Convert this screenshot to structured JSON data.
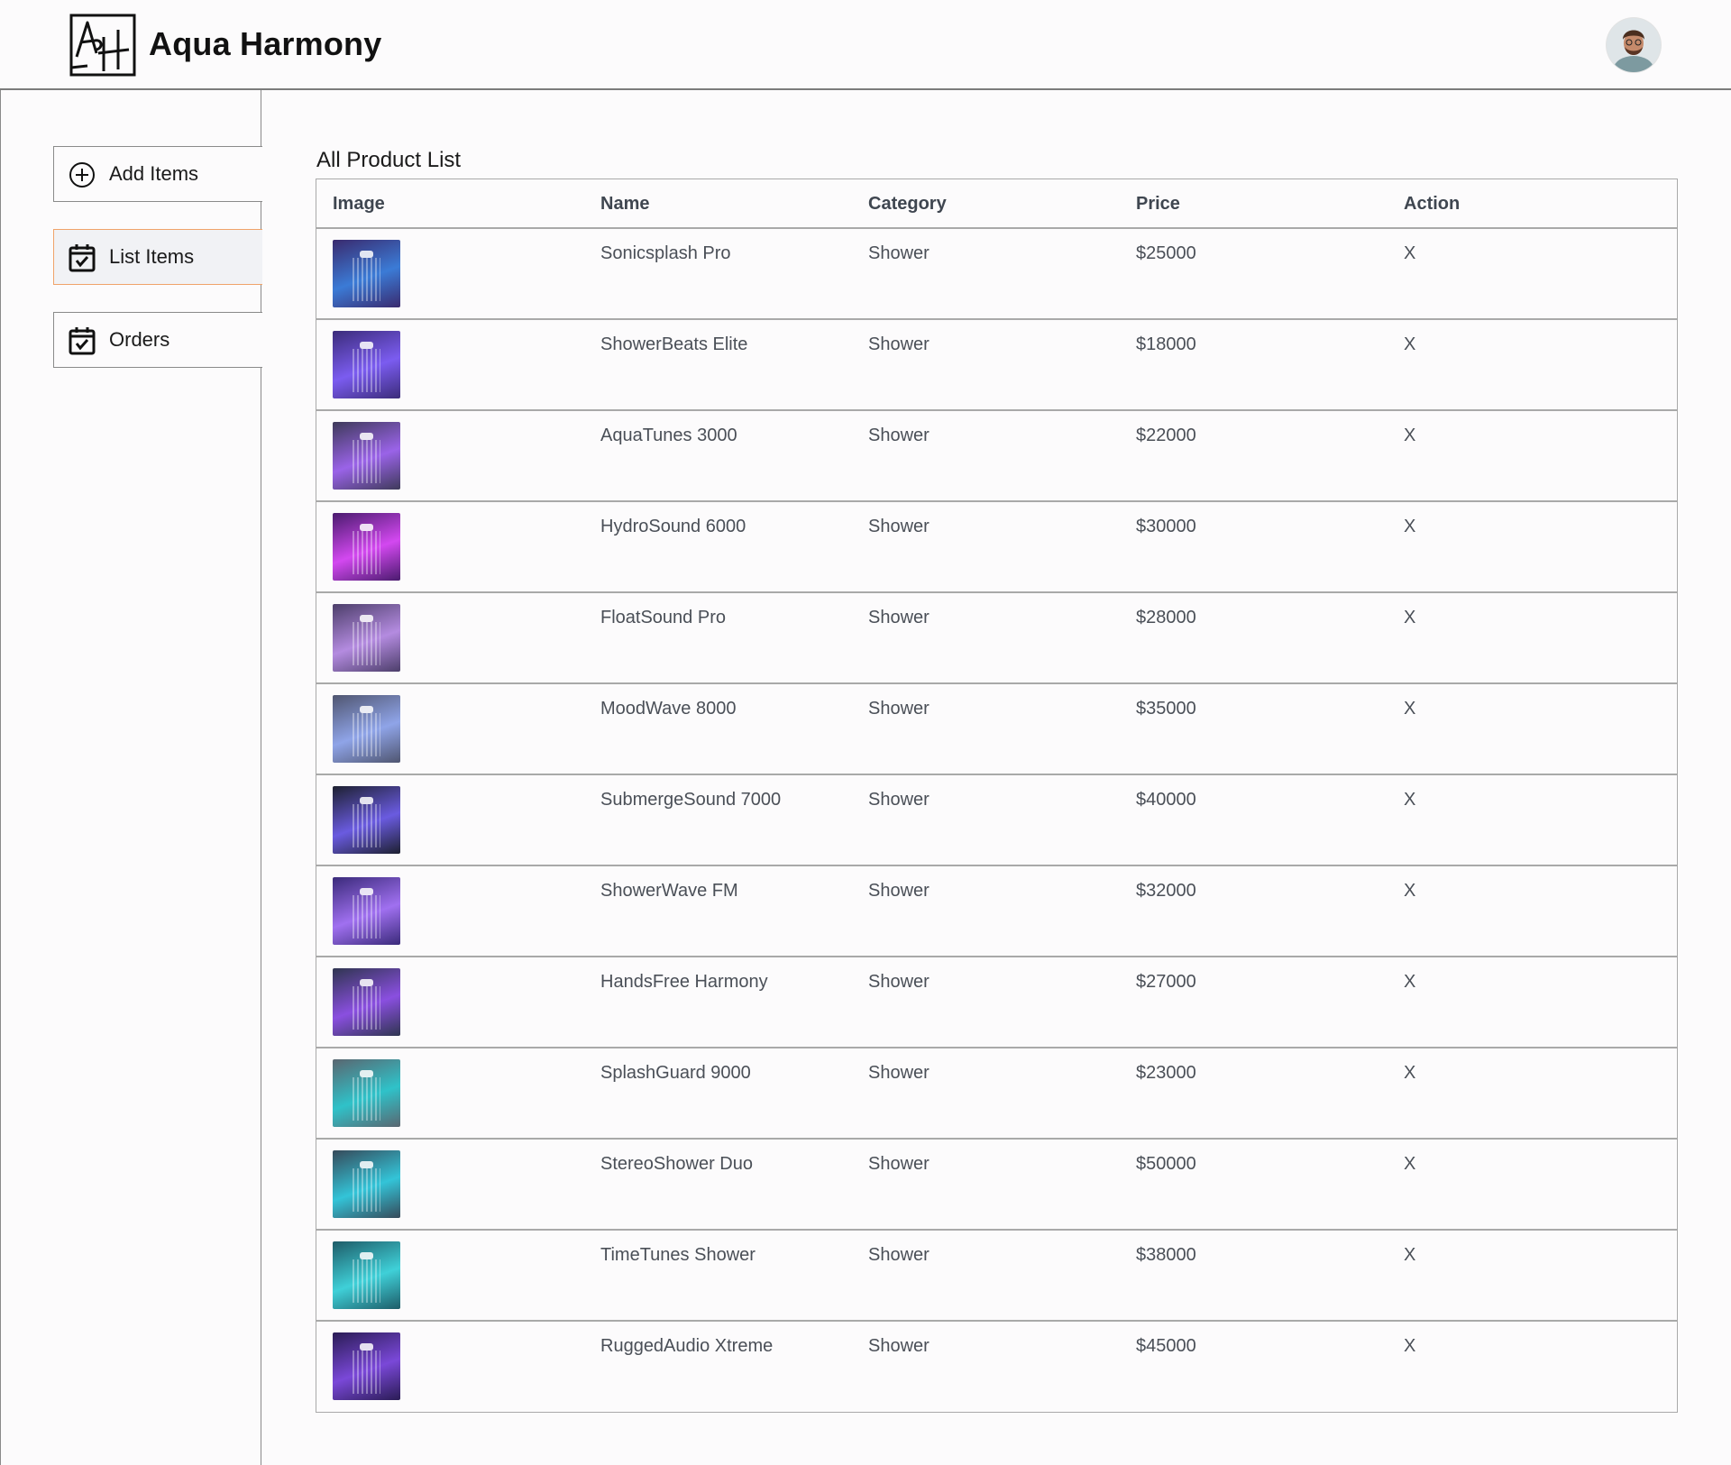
{
  "app": {
    "brand": "Aqua Harmony",
    "logo_text": "AH"
  },
  "sidebar": {
    "items": [
      {
        "label": "Add Items",
        "icon": "plus-circle-icon",
        "active": false
      },
      {
        "label": "List Items",
        "icon": "calendar-check-icon",
        "active": true
      },
      {
        "label": "Orders",
        "icon": "calendar-check-icon",
        "active": false
      }
    ]
  },
  "main": {
    "title": "All Product List",
    "columns": [
      "Image",
      "Name",
      "Category",
      "Price",
      "Action"
    ],
    "rows": [
      {
        "name": "Sonicsplash Pro",
        "category": "Shower",
        "price": "$25000",
        "action": "X",
        "colors": [
          "#3a2a6e",
          "#3b7bd6"
        ]
      },
      {
        "name": "ShowerBeats Elite",
        "category": "Shower",
        "price": "$18000",
        "action": "X",
        "colors": [
          "#3b2c7a",
          "#7b5cf0"
        ]
      },
      {
        "name": "AquaTunes 3000",
        "category": "Shower",
        "price": "$22000",
        "action": "X",
        "colors": [
          "#3e3a5a",
          "#9a63e8"
        ]
      },
      {
        "name": "HydroSound 6000",
        "category": "Shower",
        "price": "$30000",
        "action": "X",
        "colors": [
          "#4a1b6e",
          "#d348f0"
        ]
      },
      {
        "name": "FloatSound Pro",
        "category": "Shower",
        "price": "$28000",
        "action": "X",
        "colors": [
          "#4c3e6a",
          "#b48be0"
        ]
      },
      {
        "name": "MoodWave 8000",
        "category": "Shower",
        "price": "$35000",
        "action": "X",
        "colors": [
          "#4f5570",
          "#8fa4e8"
        ]
      },
      {
        "name": "SubmergeSound 7000",
        "category": "Shower",
        "price": "$40000",
        "action": "X",
        "colors": [
          "#1d2030",
          "#6a5be0"
        ]
      },
      {
        "name": "ShowerWave FM",
        "category": "Shower",
        "price": "$32000",
        "action": "X",
        "colors": [
          "#3a2a7a",
          "#a070f0"
        ]
      },
      {
        "name": "HandsFree Harmony",
        "category": "Shower",
        "price": "$27000",
        "action": "X",
        "colors": [
          "#2f3550",
          "#8a4fe0"
        ]
      },
      {
        "name": "SplashGuard 9000",
        "category": "Shower",
        "price": "$23000",
        "action": "X",
        "colors": [
          "#5a6670",
          "#2fc2c9"
        ]
      },
      {
        "name": "StereoShower Duo",
        "category": "Shower",
        "price": "$50000",
        "action": "X",
        "colors": [
          "#364a5a",
          "#33c4d8"
        ]
      },
      {
        "name": "TimeTunes Shower",
        "category": "Shower",
        "price": "$38000",
        "action": "X",
        "colors": [
          "#1e5c68",
          "#3fd0d8"
        ]
      },
      {
        "name": "RuggedAudio Xtreme",
        "category": "Shower",
        "price": "$45000",
        "action": "X",
        "colors": [
          "#2a1c55",
          "#7a48d8"
        ]
      }
    ]
  }
}
